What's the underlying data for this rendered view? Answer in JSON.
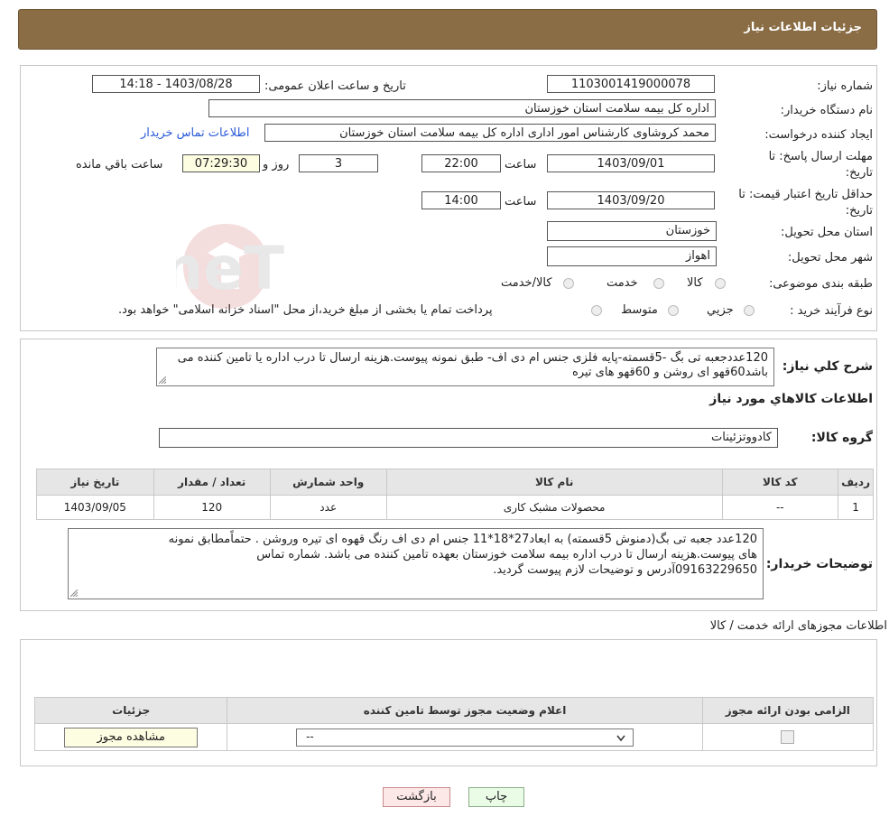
{
  "header": {
    "title": "جزئیات اطلاعات نیاز"
  },
  "fields": {
    "need_number_label": "شماره نیاز:",
    "need_number": "1103001419000078",
    "announce_label": "تاریخ و ساعت اعلان عمومی:",
    "announce_value": "1403/08/28 - 14:18",
    "buyer_label": "نام دستگاه خریدار:",
    "buyer_value": "اداره کل بیمه سلامت استان خوزستان",
    "creator_label": "ایجاد کننده درخواست:",
    "creator_value": "محمد کروشاوی کارشناس امور اداری اداره کل بیمه سلامت استان خوزستان",
    "contact_link": "اطلاعات تماس خریدار",
    "deadline_label_1": "مهلت ارسال پاسخ: تا",
    "deadline_label_2": "تاریخ:",
    "deadline_date": "1403/09/01",
    "time_word": "ساعت",
    "deadline_time": "22:00",
    "days_value": "3",
    "days_word": "روز و",
    "remaining_time": "07:29:30",
    "remaining_word": "ساعت باقي مانده",
    "validity_label_1": "حداقل تاریخ اعتبار قیمت: تا",
    "validity_label_2": "تاریخ:",
    "validity_date": "1403/09/20",
    "validity_time": "14:00",
    "province_label": "استان محل تحویل:",
    "province_value": "خوزستان",
    "city_label": "شهر محل تحویل:",
    "city_value": "اهواز",
    "category_label": "طبقه بندی موضوعی:",
    "category_options": [
      "کالا",
      "خدمت",
      "کالا/خدمت"
    ],
    "process_label": "نوع فرآیند خرید :",
    "process_options": [
      "جزیي",
      "متوسط"
    ],
    "process_note": "پرداخت تمام یا بخشی از مبلغ خرید،از محل \"اسناد خزانه اسلامی\" خواهد بود."
  },
  "summary": {
    "label": "شرح کلي نياز:",
    "text": "120عددجعبه تی بگ -5قسمته-پایه فلزی جنس ام دی اف- طبق نمونه پیوست.هزینه ارسال تا درب اداره یا تامین کننده می باشد60قهو ای روشن و 60قهو های تیره"
  },
  "goods": {
    "section_title": "اطلاعات کالاهاي مورد نياز",
    "group_label": "گروه کالا:",
    "group_value": "کادووتزئینات",
    "columns": [
      "رديف",
      "کد کالا",
      "نام کالا",
      "واحد شمارش",
      "تعداد / مقدار",
      "تاریخ نیاز"
    ],
    "rows": [
      [
        "1",
        "--",
        "محصولات مشبک کاری",
        "عدد",
        "120",
        "1403/09/05"
      ]
    ]
  },
  "buyer_notes": {
    "label": "توضیحات خریدار:",
    "line1": "120عدد جعبه تی بگ(دمنوش 5قسمته) به ابعاد27*18*11 جنس ام دی اف رنگ قهوه ای تیره وروشن . حتماًمطابق نمونه",
    "line2": "های  پیوست.هزینه ارسال تا درب اداره بیمه سلامت خوزستان بعهده تامین کننده می باشد. شماره تماس",
    "line3": "09163229650آدرس و توضیحات لازم پیوست گردید."
  },
  "licenses": {
    "section_title": "اطلاعات مجوزهای ارائه خدمت / کالا",
    "columns": [
      "الزامی بودن ارائه مجوز",
      "اعلام وضعیت مجوز توسط تامین کننده",
      "جزئیات"
    ],
    "select_value": "--",
    "view_button": "مشاهده مجوز"
  },
  "buttons": {
    "print": "چاپ",
    "back": "بازگشت"
  },
  "watermark_text": "AriaTender.neT",
  "colors": {
    "header_bg": "#8a6d45",
    "table_header_bg": "#e6e6e6",
    "highlight_box": "#fdfde2",
    "link": "#2a5bd7"
  }
}
